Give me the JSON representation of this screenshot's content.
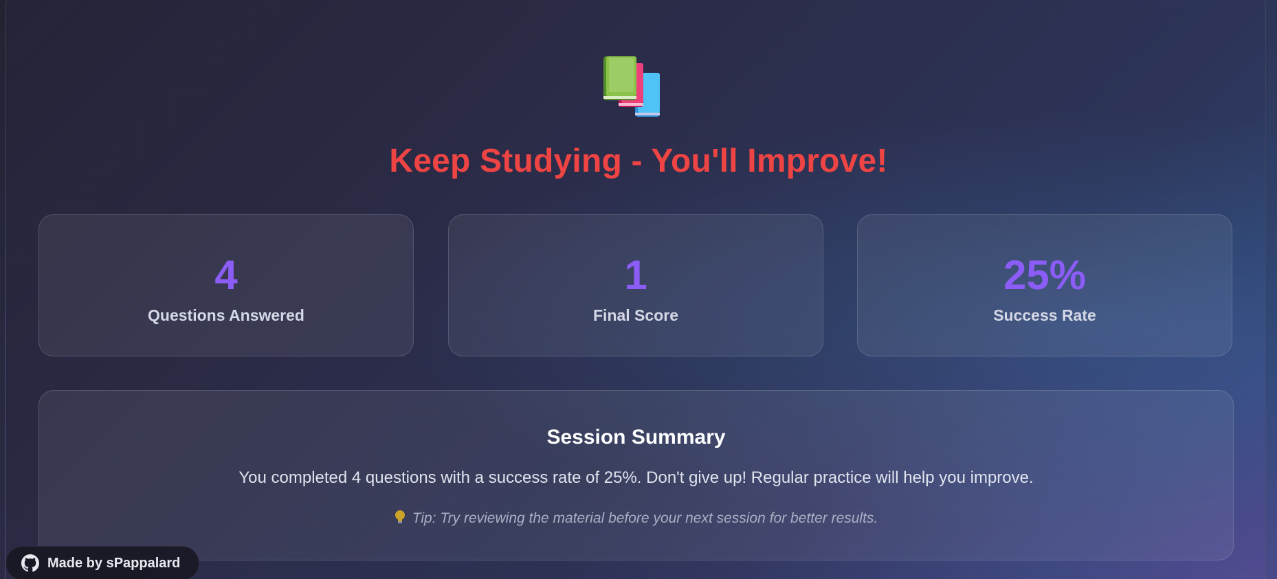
{
  "hero": {
    "icon": "books-icon",
    "title": "Keep Studying - You'll Improve!"
  },
  "stats": [
    {
      "value": "4",
      "label": "Questions Answered"
    },
    {
      "value": "1",
      "label": "Final Score"
    },
    {
      "value": "25%",
      "label": "Success Rate"
    }
  ],
  "summary": {
    "title": "Session Summary",
    "text": "You completed 4 questions with a success rate of 25%. Don't give up! Regular practice will help you improve.",
    "tip_icon": "lightbulb-icon",
    "tip": "Tip: Try reviewing the material before your next session for better results."
  },
  "footer": {
    "badge_icon": "github-icon",
    "badge_label": "Made by sPappalard"
  },
  "colors": {
    "title": "#ef4444",
    "stat_value": "#8b5cf6",
    "background": "#2c2c48"
  }
}
